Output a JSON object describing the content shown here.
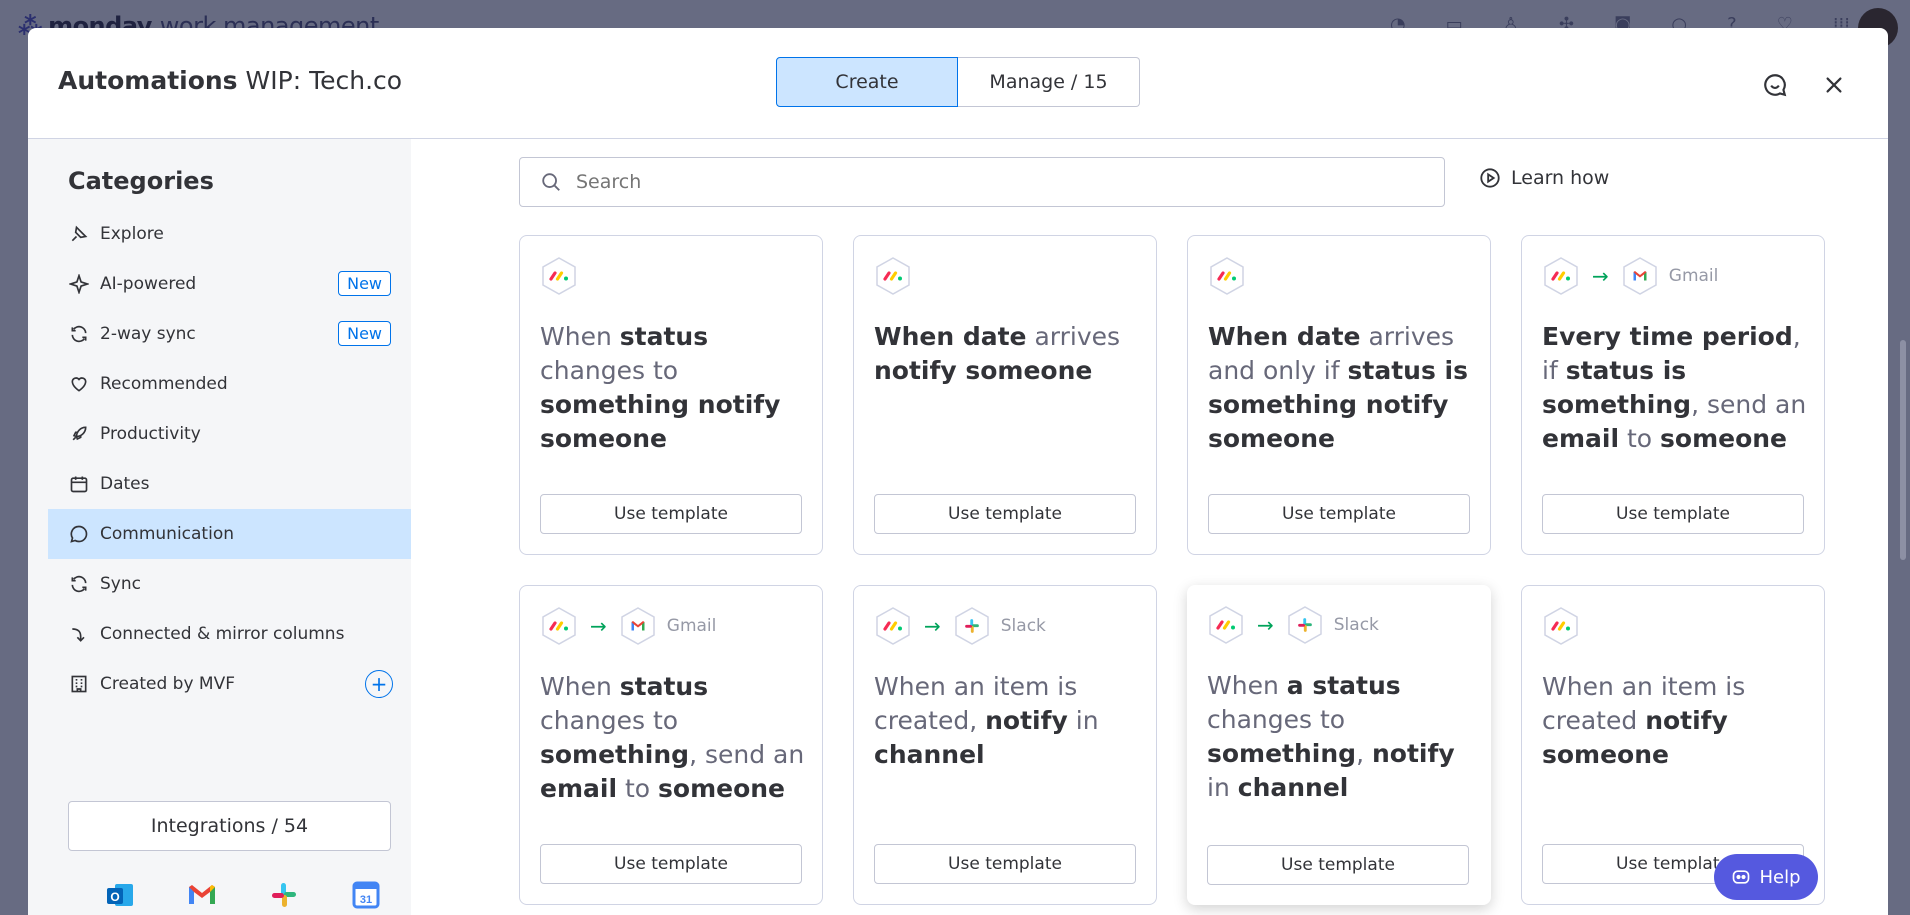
{
  "background_app": {
    "brand_bold": "monday",
    "brand_light": "work management"
  },
  "header": {
    "title_bold": "Automations",
    "title_rest": "WIP: Tech.co",
    "tabs": [
      {
        "label": "Create",
        "active": true
      },
      {
        "label": "Manage / 15",
        "active": false
      }
    ]
  },
  "sidebar": {
    "title": "Categories",
    "items": [
      {
        "label": "Explore",
        "icon": "explore-icon"
      },
      {
        "label": "AI-powered",
        "icon": "sparkle-icon",
        "badge": "New"
      },
      {
        "label": "2-way sync",
        "icon": "sync-icon",
        "badge": "New"
      },
      {
        "label": "Recommended",
        "icon": "heart-icon"
      },
      {
        "label": "Productivity",
        "icon": "rocket-icon"
      },
      {
        "label": "Dates",
        "icon": "calendar-icon"
      },
      {
        "label": "Communication",
        "icon": "chat-icon",
        "active": true
      },
      {
        "label": "Sync",
        "icon": "sync-icon"
      },
      {
        "label": "Connected & mirror columns",
        "icon": "connect-icon"
      },
      {
        "label": "Created by MVF",
        "icon": "building-icon"
      }
    ],
    "integrations_label": "Integrations / 54",
    "integration_logos": [
      "outlook-icon",
      "gmail-icon",
      "slack-icon",
      "google-calendar-icon"
    ]
  },
  "search": {
    "placeholder": "Search"
  },
  "learn_how": "Learn how",
  "cards": [
    {
      "apps": [],
      "text_parts": [
        [
          "When ",
          false
        ],
        [
          "status",
          true
        ],
        [
          " changes to ",
          false
        ],
        [
          "something notify someone",
          true
        ]
      ],
      "button": "Use template"
    },
    {
      "apps": [],
      "text_parts": [
        [
          "When date",
          true
        ],
        [
          " arrives ",
          false
        ],
        [
          "notify someone",
          true
        ]
      ],
      "button": "Use template"
    },
    {
      "apps": [],
      "text_parts": [
        [
          "When date",
          true
        ],
        [
          " arrives and only if ",
          false
        ],
        [
          "status is something notify someone",
          true
        ]
      ],
      "button": "Use template"
    },
    {
      "apps": [
        "Gmail"
      ],
      "text_parts": [
        [
          "Every time period",
          true
        ],
        [
          ", if ",
          false
        ],
        [
          "status is something",
          true
        ],
        [
          ", send an ",
          false
        ],
        [
          "email",
          true
        ],
        [
          " to ",
          false
        ],
        [
          "someone",
          true
        ]
      ],
      "button": "Use template"
    },
    {
      "apps": [
        "Gmail"
      ],
      "text_parts": [
        [
          "When ",
          false
        ],
        [
          "status",
          true
        ],
        [
          " changes to ",
          false
        ],
        [
          "something",
          true
        ],
        [
          ", send an ",
          false
        ],
        [
          "email",
          true
        ],
        [
          " to ",
          false
        ],
        [
          "someone",
          true
        ]
      ],
      "button": "Use template"
    },
    {
      "apps": [
        "Slack"
      ],
      "text_parts": [
        [
          "When an item is created, ",
          false
        ],
        [
          "notify",
          true
        ],
        [
          " in ",
          false
        ],
        [
          "channel",
          true
        ]
      ],
      "button": "Use template"
    },
    {
      "apps": [
        "Slack"
      ],
      "text_parts": [
        [
          "When ",
          false
        ],
        [
          "a status",
          true
        ],
        [
          " changes to ",
          false
        ],
        [
          "something",
          true
        ],
        [
          ", ",
          false
        ],
        [
          "notify",
          true
        ],
        [
          " in ",
          false
        ],
        [
          "channel",
          true
        ]
      ],
      "button": "Use template"
    },
    {
      "apps": [],
      "text_parts": [
        [
          "When an item is created ",
          false
        ],
        [
          "notify someone",
          true
        ]
      ],
      "button": "Use template"
    }
  ],
  "help_label": "Help",
  "colors": {
    "primary": "#0073ea",
    "selected_bg": "#cce5ff",
    "help_button": "#5559df",
    "arrow_green": "#00a35a"
  }
}
